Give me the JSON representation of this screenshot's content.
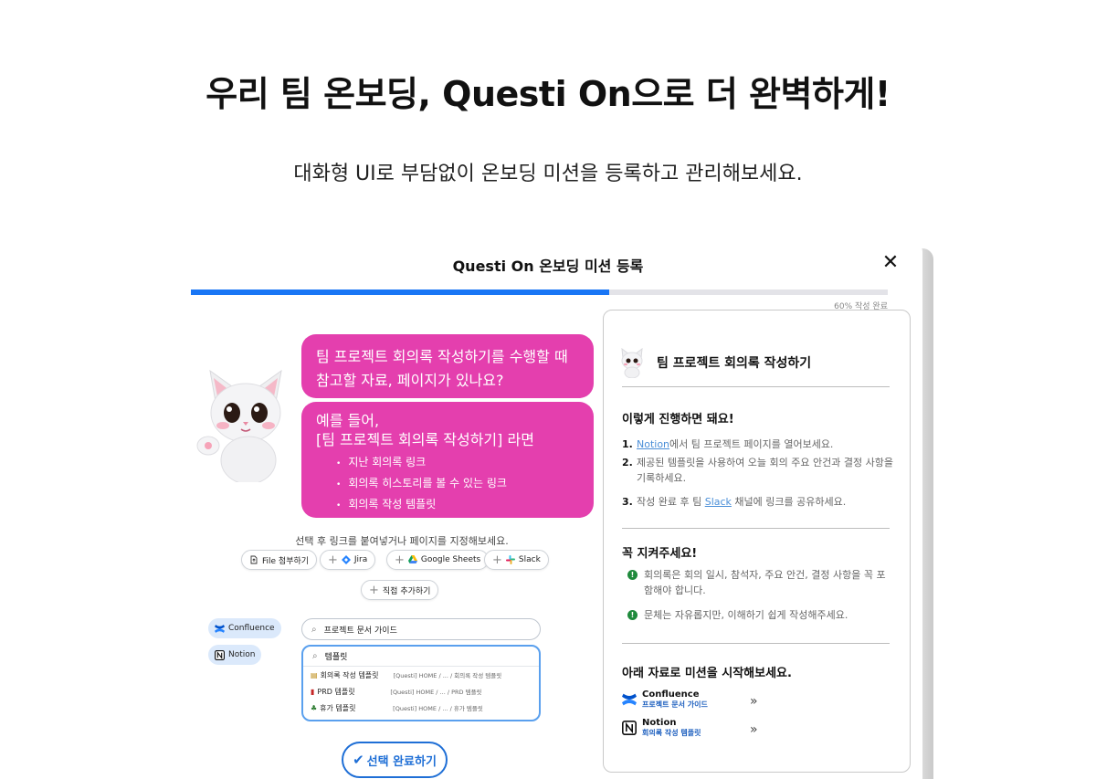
{
  "headline": "우리 팀 온보딩, Questi On으로 더 완벽하게!",
  "subline": "대화형 UI로 부담없이 온보딩 미션을 등록하고 관리해보세요.",
  "modal": {
    "title": "Questi On 온보딩 미션 등록",
    "close": "✕",
    "progress": {
      "value": 0.6,
      "label": "60% 작성 완료"
    }
  },
  "chat": {
    "bubble1": "팀 프로젝트 회의록 작성하기를 수행할 때 참고할 자료, 페이지가 있나요?",
    "bubble2_line1": "예를 들어,",
    "bubble2_line2": "[팀 프로젝트 회의록 작성하기] 라면",
    "bubble2_items": [
      "지난 회의록 링크",
      "회의록 히스토리를 볼 수 있는 링크",
      "회의록 작성 템플릿"
    ]
  },
  "hint": "선택 후 링크를 붙여넣거나 페이지를 지정해보세요.",
  "chips": {
    "file": "File 첨부하기",
    "jira": "Jira",
    "sheets": "Google Sheets",
    "slack": "Slack",
    "direct": "직접 추가하기"
  },
  "side_chips": {
    "confluence": "Confluence",
    "notion": "Notion"
  },
  "search1": {
    "value": "프로젝트 문서 가이드"
  },
  "search2": {
    "value": "템플릿",
    "results": [
      {
        "name": "회의록 작성 템플릿",
        "path": "[Questi] HOME / ... / 회의록 작성 템플릿",
        "icon": "memo-icon"
      },
      {
        "name": "PRD 템플릿",
        "path": "[Questi] HOME / ... / PRD 템플릿",
        "icon": "book-icon"
      },
      {
        "name": "휴가 템플릿",
        "path": "[Questi] HOME / ... / 휴가 템플릿",
        "icon": "palm-icon"
      }
    ]
  },
  "confirm": "선택 완료하기",
  "panel": {
    "title": "팀 프로젝트 회의록 작성하기",
    "section1": "이렇게 진행하면 돼요!",
    "steps": [
      {
        "num": "1.",
        "link": "Notion",
        "text": "에서 팀 프로젝트 페이지를 열어보세요."
      },
      {
        "num": "2.",
        "text": "제공된 템플릿을 사용하여 오늘 회의 주요 안건과 결정 사항을 기록하세요."
      },
      {
        "num": "3.",
        "pre": "작성 완료 후 팀 ",
        "link": "Slack",
        "text": " 채널에 링크를 공유하세요."
      }
    ],
    "section2": "꼭 지켜주세요!",
    "rules": [
      "회의록은 회의 일시, 참석자, 주요 안건, 결정 사항을 꼭 포함해야 합니다.",
      "문체는 자유롭지만, 이해하기 쉽게 작성해주세요."
    ],
    "section3": "아래 자료로 미션을 시작해보세요.",
    "resources": [
      {
        "name": "Confluence",
        "sub": "프로젝트 문서 가이드",
        "arrow": "»"
      },
      {
        "name": "Notion",
        "sub": "회의록 작성 템플릿",
        "arrow": "»"
      }
    ]
  },
  "colors": {
    "accent": "#1976f5",
    "bubble": "#e43fae",
    "confirm": "#1f6fd6",
    "success": "#1f8a3c"
  }
}
